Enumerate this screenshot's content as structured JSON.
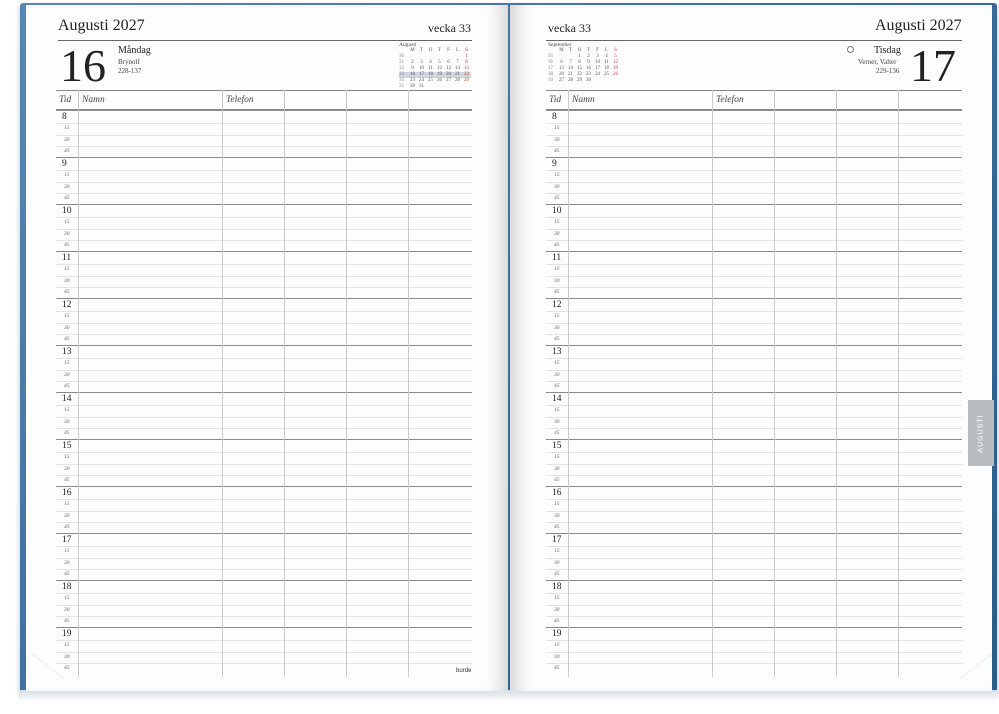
{
  "left_page": {
    "month": "Augusti 2027",
    "week": "vecka 33",
    "day_number": "16",
    "day_name": "Måndag",
    "name_day": "Brynolf",
    "day_of_year": "228-137",
    "minical": {
      "title": "Augusti",
      "header": [
        "",
        "M",
        "T",
        "O",
        "T",
        "F",
        "L",
        "S"
      ],
      "rows": [
        [
          "30",
          "",
          "",
          "",
          "",
          "",
          "",
          "1"
        ],
        [
          "31",
          "2",
          "3",
          "4",
          "5",
          "6",
          "7",
          "8"
        ],
        [
          "32",
          "9",
          "10",
          "11",
          "12",
          "13",
          "14",
          "15"
        ],
        [
          "33",
          "16",
          "17",
          "18",
          "19",
          "20",
          "21",
          "22"
        ],
        [
          "34",
          "23",
          "24",
          "25",
          "26",
          "27",
          "28",
          "29"
        ],
        [
          "35",
          "30",
          "31",
          "",
          "",
          "",
          "",
          ""
        ]
      ]
    },
    "brand": "burde"
  },
  "right_page": {
    "month": "Augusti 2027",
    "week": "vecka 33",
    "day_number": "17",
    "day_name": "Tisdag",
    "name_day": "Verner, Valter",
    "day_of_year": "229-136",
    "minical": {
      "title": "September",
      "header": [
        "",
        "M",
        "T",
        "O",
        "T",
        "F",
        "L",
        "S"
      ],
      "rows": [
        [
          "35",
          "",
          "",
          "1",
          "2",
          "3",
          "4",
          "5"
        ],
        [
          "36",
          "6",
          "7",
          "8",
          "9",
          "10",
          "11",
          "12"
        ],
        [
          "37",
          "13",
          "14",
          "15",
          "16",
          "17",
          "18",
          "19"
        ],
        [
          "38",
          "20",
          "21",
          "22",
          "23",
          "24",
          "25",
          "26"
        ],
        [
          "39",
          "27",
          "28",
          "29",
          "30",
          "",
          "",
          ""
        ]
      ]
    },
    "tab_label": "AUGUSTI"
  },
  "columns": {
    "time": "Tid",
    "name": "Namn",
    "phone": "Telefon"
  },
  "hours": [
    "8",
    "9",
    "10",
    "11",
    "12",
    "13",
    "14",
    "15",
    "16",
    "17",
    "18",
    "19"
  ],
  "minutes": [
    "15",
    "30",
    "45"
  ],
  "colors": {
    "cover": "#3f6d9e",
    "sunday_red": "#c0392b",
    "tab": "#b9bdc1"
  }
}
